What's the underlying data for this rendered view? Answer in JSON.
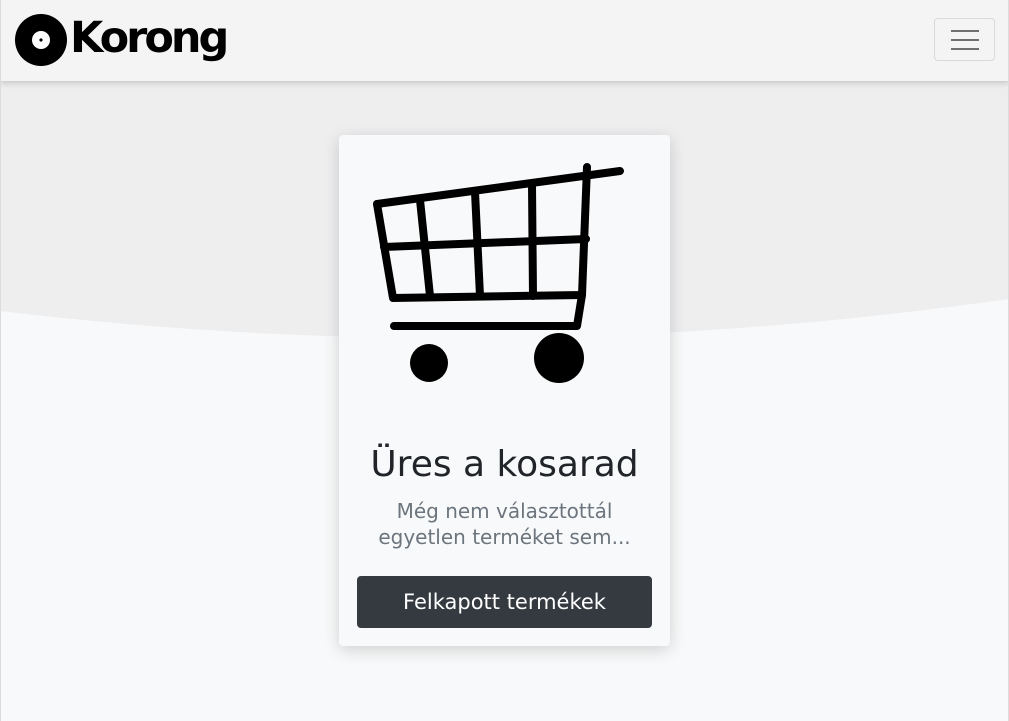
{
  "navbar": {
    "brand_text": "Korong",
    "logo_icon": "vinyl-disc-icon",
    "toggler_icon": "hamburger-menu-icon"
  },
  "empty_cart": {
    "icon": "shopping-cart-icon",
    "title": "Üres a kosarad",
    "message": "Még nem választottál egyetlen terméket sem...",
    "button_label": "Felkapott termékek"
  },
  "colors": {
    "navbar_bg": "#f4f4f4",
    "hero_band": "#eeeeef",
    "page_bg": "#f8f9fa",
    "button_bg": "#343a40",
    "muted_text": "#6c757d"
  }
}
